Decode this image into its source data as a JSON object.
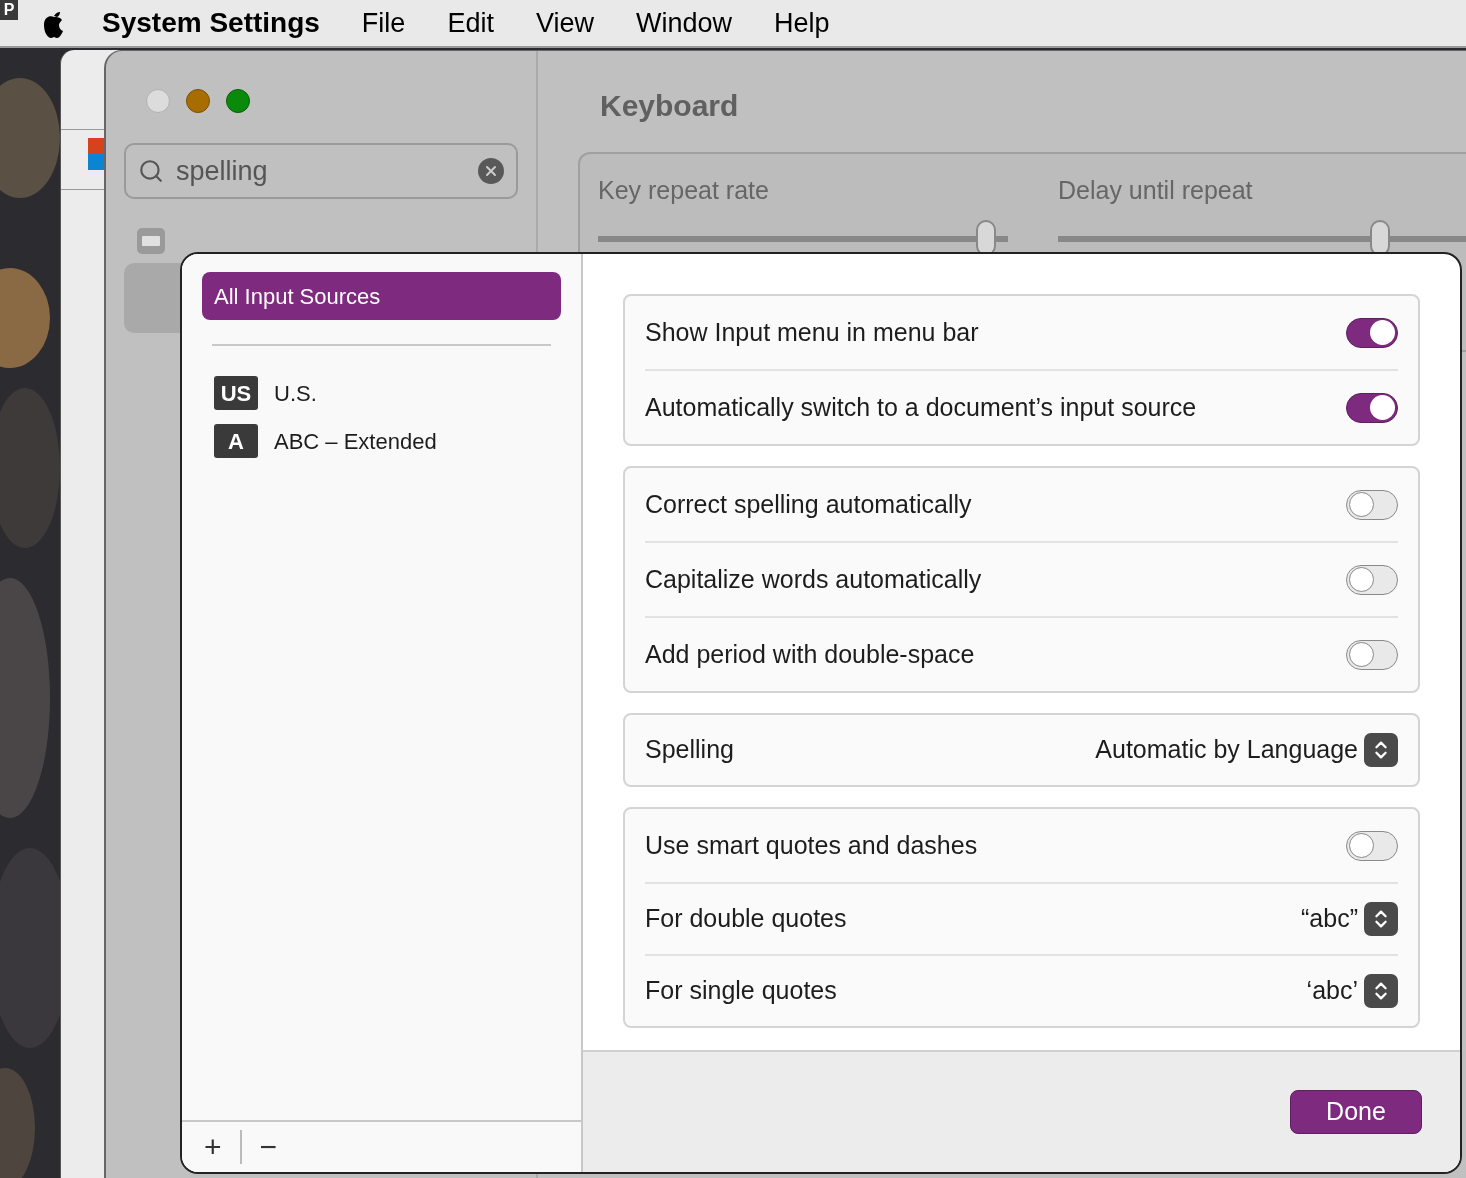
{
  "menu_bar": {
    "corner_letter": "P",
    "app": "System Settings",
    "items": [
      "File",
      "Edit",
      "View",
      "Window",
      "Help"
    ]
  },
  "window": {
    "search": {
      "value": "spelling"
    },
    "title": "Keyboard",
    "sliders": [
      {
        "label": "Key repeat rate",
        "level": 0.97
      },
      {
        "label": "Delay until repeat",
        "level": 0.8
      }
    ]
  },
  "sheet": {
    "sources": [
      {
        "label": "All Input Sources",
        "selected": true
      }
    ],
    "input_sources": [
      {
        "badge": "US",
        "name": "U.S.",
        "selected": false
      },
      {
        "badge": "A",
        "name": "ABC – Extended",
        "selected": false
      }
    ],
    "list_buttons": [
      "+",
      "−"
    ],
    "groups": [
      [
        {
          "kind": "toggle",
          "label": "Show Input menu in menu bar",
          "on": true
        },
        {
          "kind": "toggle",
          "label": "Automatically switch to a document’s input source",
          "on": true
        }
      ],
      [
        {
          "kind": "toggle",
          "label": "Correct spelling automatically",
          "on": false
        },
        {
          "kind": "toggle",
          "label": "Capitalize words automatically",
          "on": false
        },
        {
          "kind": "toggle",
          "label": "Add period with double-space",
          "on": false
        }
      ],
      [
        {
          "kind": "popup",
          "label": "Spelling",
          "value": "Automatic by Language"
        }
      ],
      [
        {
          "kind": "toggle",
          "label": "Use smart quotes and dashes",
          "on": false
        },
        {
          "kind": "popup",
          "label": "For double quotes",
          "value": "“abc”"
        },
        {
          "kind": "popup",
          "label": "For single quotes",
          "value": "‘abc’"
        }
      ]
    ],
    "done": "Done"
  }
}
